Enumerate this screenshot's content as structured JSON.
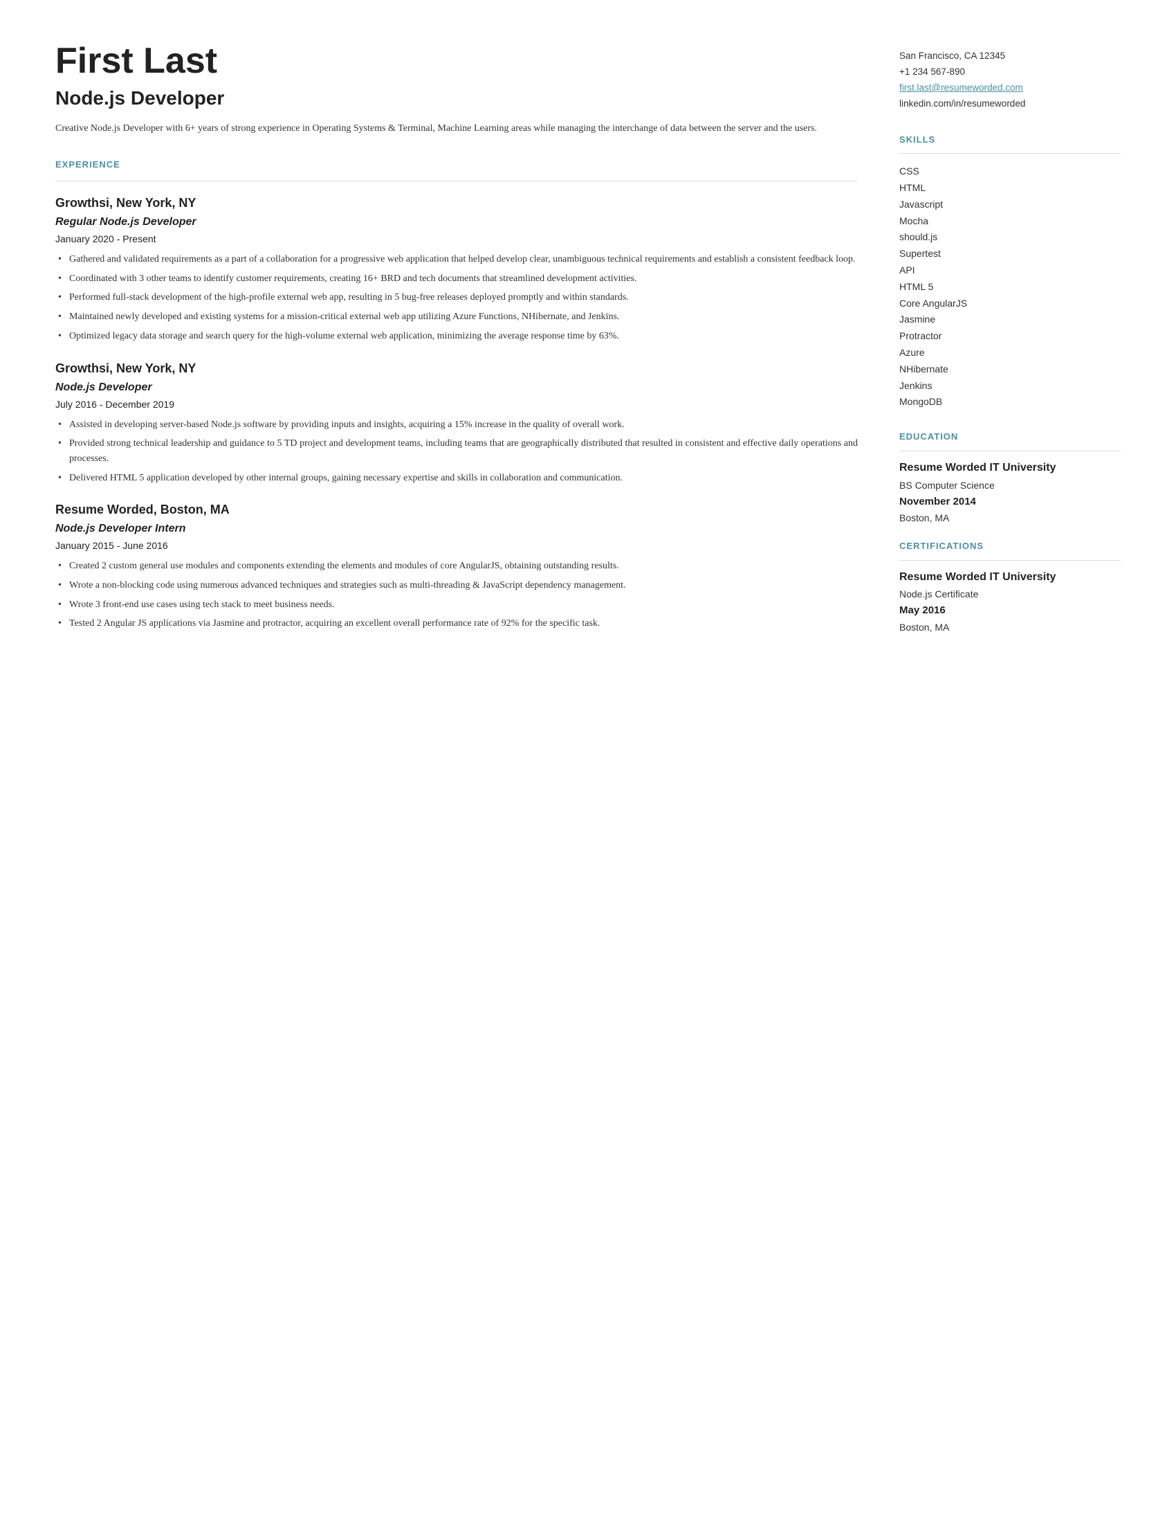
{
  "header": {
    "name": "First Last",
    "title": "Node.js Developer",
    "summary": "Creative Node.js Developer with 6+ years of strong experience in Operating Systems & Terminal, Machine Learning areas while managing the interchange of data between the server and the users."
  },
  "contact": {
    "address": "San Francisco, CA 12345",
    "phone": "+1 234 567-890",
    "email": "first.last@resumeworded.com",
    "linkedin": "linkedin.com/in/resumeworded"
  },
  "sections": {
    "experience_label": "EXPERIENCE",
    "skills_label": "SKILLS",
    "education_label": "EDUCATION",
    "certifications_label": "CERTIFICATIONS"
  },
  "experience": [
    {
      "company": "Growthsi,",
      "location": "New York, NY",
      "role": "Regular Node.js Developer",
      "dates": "January 2020 - Present",
      "bullets": [
        "Gathered and validated requirements as a part of a collaboration for a progressive web application that helped develop clear, unambiguous technical requirements and establish a consistent feedback loop.",
        "Coordinated with 3 other teams to identify customer requirements, creating 16+ BRD and tech documents that streamlined development activities.",
        "Performed full-stack development of the high-profile external web app, resulting in 5 bug-free releases deployed promptly and within standards.",
        "Maintained newly developed and existing systems for a mission-critical external web app utilizing Azure Functions, NHibernate, and Jenkins.",
        "Optimized legacy data storage and search query for the high-volume external web application, minimizing the average response time by 63%."
      ]
    },
    {
      "company": "Growthsi,",
      "location": "New York, NY",
      "role": "Node.js Developer",
      "dates": "July 2016 - December 2019",
      "bullets": [
        "Assisted in developing server-based Node.js software by providing inputs and insights, acquiring a 15% increase in the quality of overall work.",
        "Provided strong technical leadership and guidance to 5 TD project and development teams, including teams that are geographically distributed that resulted in consistent and effective daily operations and processes.",
        "Delivered HTML 5 application developed by other internal groups, gaining necessary expertise and skills in collaboration and communication."
      ]
    },
    {
      "company": "Resume Worded,",
      "location": "Boston, MA",
      "role": "Node.js Developer Intern",
      "dates": "January 2015 - June 2016",
      "bullets": [
        "Created 2 custom general use modules and components extending the elements and modules of core AngularJS, obtaining outstanding results.",
        "Wrote a non-blocking code using numerous advanced techniques and strategies such as multi-threading & JavaScript dependency management.",
        "Wrote 3 front-end use cases using tech stack to meet business needs.",
        "Tested 2 Angular JS applications via Jasmine and protractor, acquiring an excellent overall performance rate of 92% for the specific task."
      ]
    }
  ],
  "skills": [
    "CSS",
    "HTML",
    "Javascript",
    "Mocha",
    "should.js",
    "Supertest",
    "API",
    "HTML 5",
    "Core AngularJS",
    "Jasmine",
    "Protractor",
    "Azure",
    "NHibernate",
    "Jenkins",
    "MongoDB"
  ],
  "education": [
    {
      "school": "Resume Worded IT University",
      "degree": "BS Computer Science",
      "date": "November 2014",
      "location": "Boston, MA"
    }
  ],
  "certifications": [
    {
      "school": "Resume Worded IT University",
      "cert": "Node.js Certificate",
      "date": "May 2016",
      "location": "Boston, MA"
    }
  ]
}
